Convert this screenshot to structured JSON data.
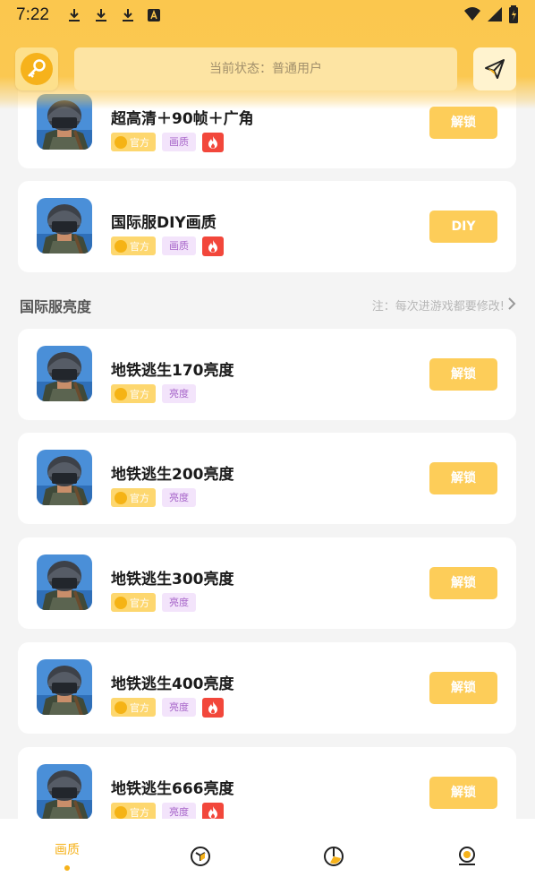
{
  "status_bar": {
    "time": "7:22"
  },
  "top_bar": {
    "status_text": "当前状态：普通用户"
  },
  "colors": {
    "accent": "#fbc74e",
    "button": "#fdcd59",
    "hot": "#f2473b",
    "tag_purple": "#f3e4fb"
  },
  "cards_top": [
    {
      "title": "超高清＋90帧＋广角",
      "tags": [
        "官方",
        "画质"
      ],
      "hot": true,
      "action": "解锁"
    },
    {
      "title": "国际服DIY画质",
      "tags": [
        "官方",
        "画质"
      ],
      "hot": true,
      "action": "DIY"
    }
  ],
  "section": {
    "title": "国际服亮度",
    "note": "注：每次进游戏都要修改!"
  },
  "cards": [
    {
      "title": "地铁逃生170亮度",
      "tags": [
        "官方",
        "亮度"
      ],
      "hot": false,
      "action": "解锁"
    },
    {
      "title": "地铁逃生200亮度",
      "tags": [
        "官方",
        "亮度"
      ],
      "hot": false,
      "action": "解锁"
    },
    {
      "title": "地铁逃生300亮度",
      "tags": [
        "官方",
        "亮度"
      ],
      "hot": false,
      "action": "解锁"
    },
    {
      "title": "地铁逃生400亮度",
      "tags": [
        "官方",
        "亮度"
      ],
      "hot": true,
      "action": "解锁"
    },
    {
      "title": "地铁逃生666亮度",
      "tags": [
        "官方",
        "亮度"
      ],
      "hot": true,
      "action": "解锁"
    }
  ],
  "bottom_nav": [
    {
      "label": "画质",
      "active": true,
      "icon": "quality-icon"
    },
    {
      "label": "",
      "active": false,
      "icon": "cube-icon"
    },
    {
      "label": "",
      "active": false,
      "icon": "pie-chart-icon"
    },
    {
      "label": "",
      "active": false,
      "icon": "profile-icon"
    }
  ]
}
